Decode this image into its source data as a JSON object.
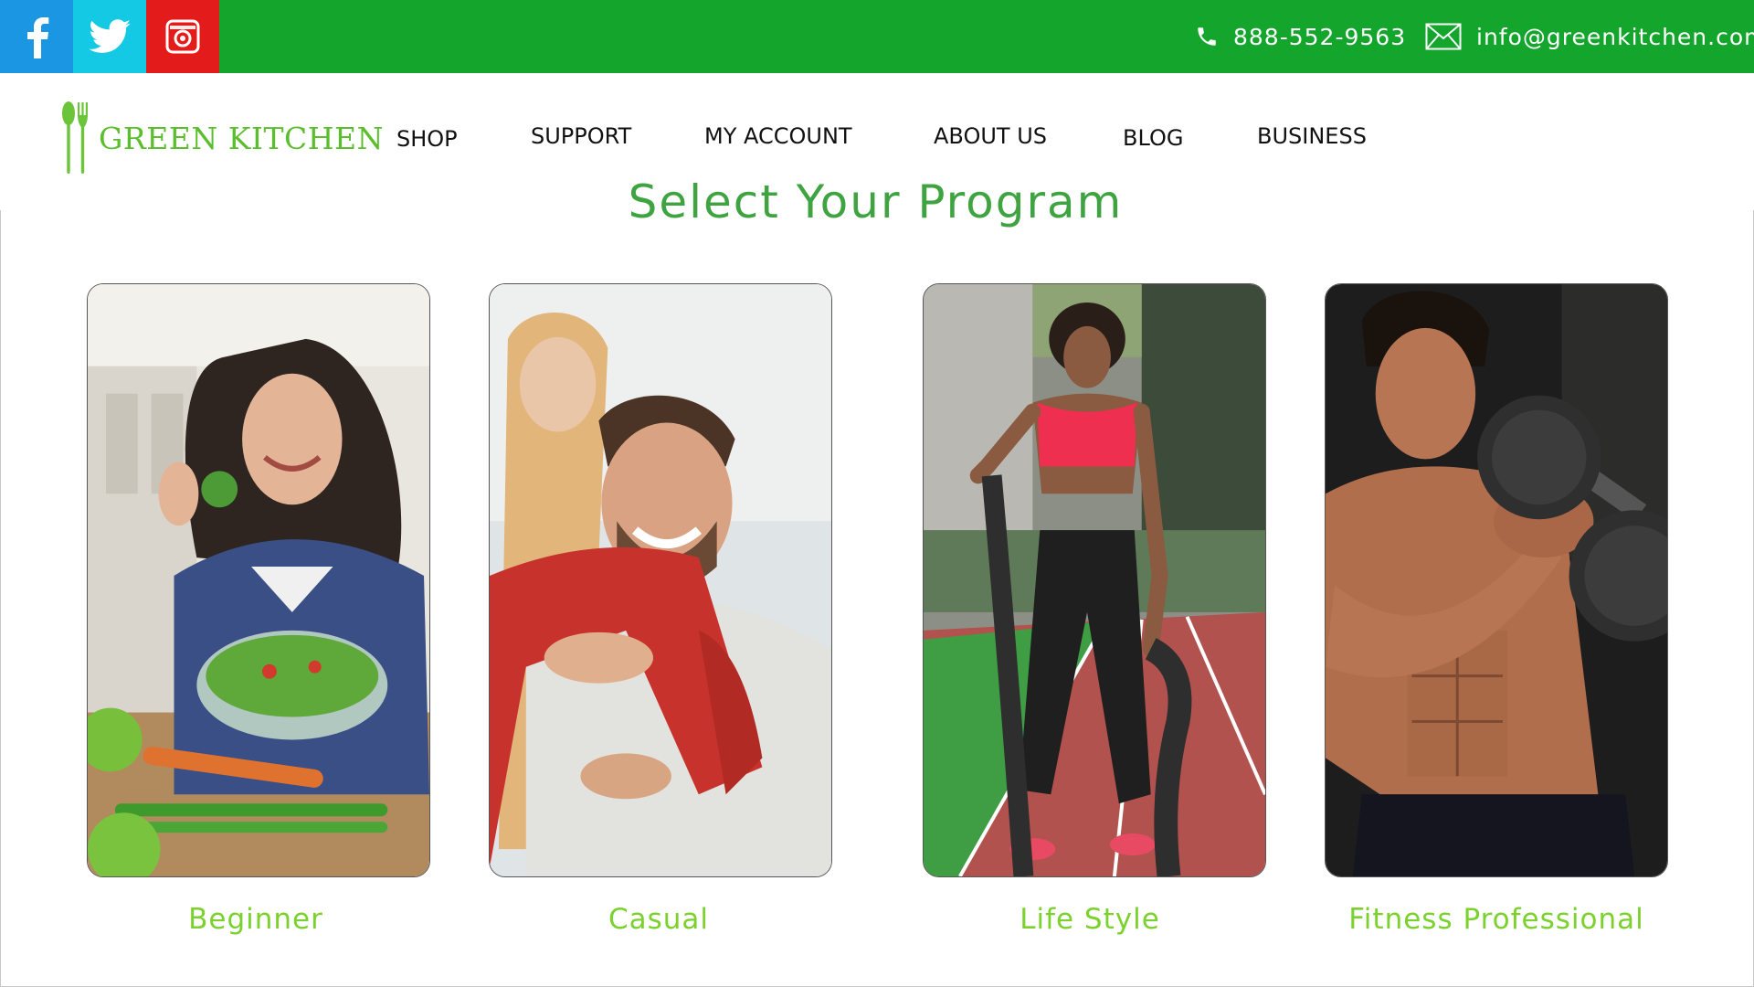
{
  "topbar": {
    "social": [
      {
        "name": "facebook",
        "icon": "facebook-icon",
        "color": "#1a96e3"
      },
      {
        "name": "twitter",
        "icon": "twitter-icon",
        "color": "#14c9e3"
      },
      {
        "name": "instagram",
        "icon": "instagram-icon",
        "color": "#e41b1b"
      }
    ],
    "phone": "888-552-9563",
    "email": "info@greenkitchen.com",
    "background_color": "#13a52c"
  },
  "header": {
    "logo_text": "GREEN KITCHEN",
    "logo_icon": "fork-spoon-icon",
    "nav": {
      "shop": "SHOP",
      "support": "SUPPORT",
      "my_account": "MY ACCOUNT",
      "about_us": "ABOUT US",
      "blog": "BLOG",
      "business": "BUSINESS"
    }
  },
  "main": {
    "title": "Select Your Program",
    "programs": [
      {
        "label": "Beginner",
        "image": "woman-eating-salad-photo"
      },
      {
        "label": "Casual",
        "image": "couple-laughing-photo"
      },
      {
        "label": "Life Style",
        "image": "woman-battle-ropes-photo"
      },
      {
        "label": "Fitness Professional",
        "image": "man-lifting-dumbbell-photo"
      }
    ]
  },
  "colors": {
    "accent_green": "#5bbf2d",
    "title_green": "#3ea340",
    "label_green": "#7bd12d"
  }
}
